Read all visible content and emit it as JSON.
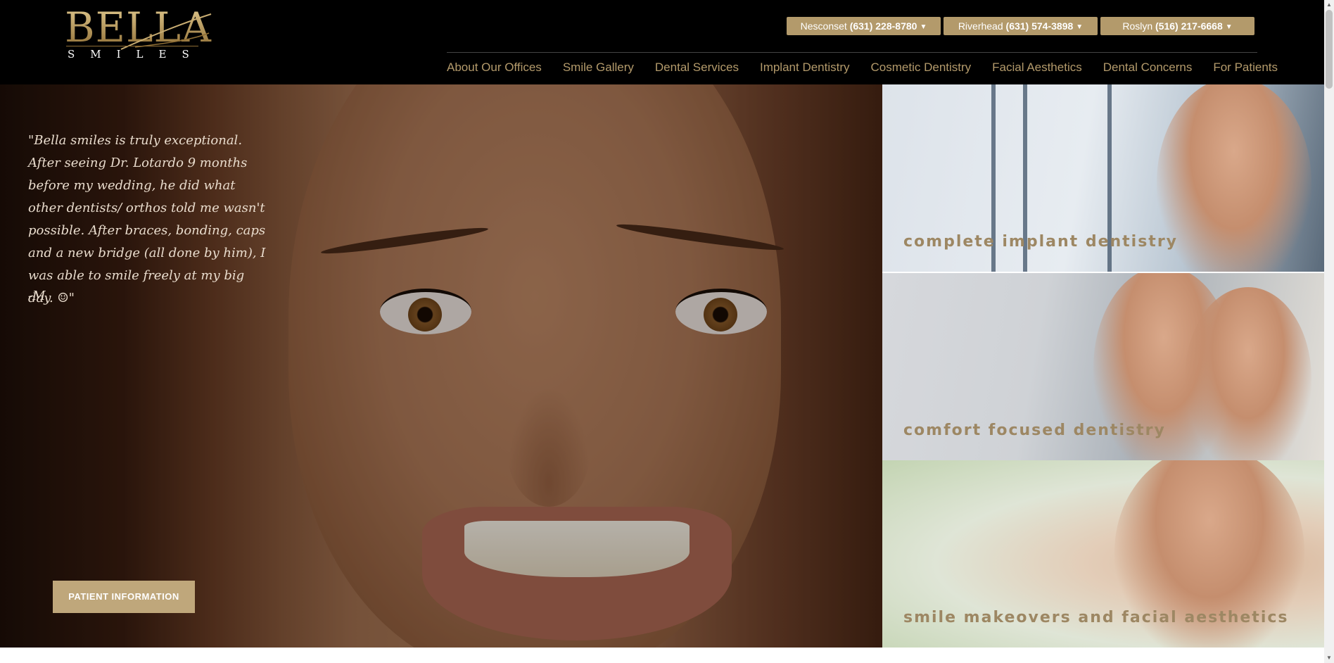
{
  "logo": {
    "word": "BELLA",
    "sub": "SMILES"
  },
  "offices": [
    {
      "name": "Nesconset",
      "phone": "(631) 228-8780"
    },
    {
      "name": "Riverhead",
      "phone": "(631) 574-3898"
    },
    {
      "name": "Roslyn",
      "phone": "(516) 217-6668"
    }
  ],
  "nav": [
    "About Our Offices",
    "Smile Gallery",
    "Dental Services",
    "Implant Dentistry",
    "Cosmetic Dentistry",
    "Facial Aesthetics",
    "Dental Concerns",
    "For Patients"
  ],
  "hero": {
    "quote": "\"Bella smiles is truly exceptional. After seeing Dr. Lotardo 9 months before my wedding, he did what other dentists/ orthos told me wasn't possible. After braces, bonding, caps and a new bridge (all done by him), I was able to smile freely at my big day. ☺\"",
    "author": "-M",
    "button": "PATIENT INFORMATION"
  },
  "tiles": [
    "complete implant dentistry",
    "comfort focused dentistry",
    "smile makeovers and facial aesthetics"
  ],
  "colors": {
    "header_bg": "#000000",
    "gold": "#b39a6b",
    "nav_text": "#b39a6b",
    "tile_label": "#9d8763"
  }
}
